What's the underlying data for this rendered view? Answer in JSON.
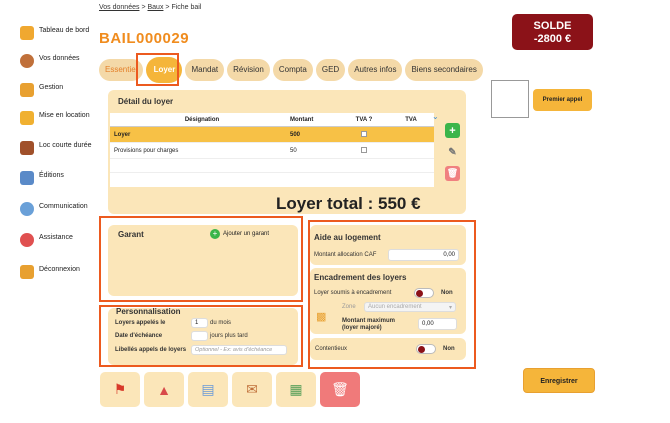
{
  "sidebar": {
    "items": [
      {
        "label": "Tableau de bord",
        "icon": "dashboard-icon",
        "color": "#f0a830"
      },
      {
        "label": "Vos données",
        "icon": "user-icon",
        "color": "#c0703a"
      },
      {
        "label": "Gestion",
        "icon": "building-icon",
        "color": "#e8a030"
      },
      {
        "label": "Mise en location",
        "icon": "key-icon",
        "color": "#f0b030"
      },
      {
        "label": "Loc courte durée",
        "icon": "suitcase-icon",
        "color": "#a0502a"
      },
      {
        "label": "Éditions",
        "icon": "document-icon",
        "color": "#5a8ac8"
      },
      {
        "label": "Communication",
        "icon": "chat-icon",
        "color": "#6aa0d8"
      },
      {
        "label": "Assistance",
        "icon": "support-icon",
        "color": "#e05050"
      },
      {
        "label": "Déconnexion",
        "icon": "logout-icon",
        "color": "#e8a030"
      }
    ]
  },
  "breadcrumb": {
    "link1": "Vos données",
    "sep1": ">",
    "link2": "Baux",
    "sep2": ">",
    "current": "Fiche bail"
  },
  "lease_code": "BAIL000029",
  "solde": {
    "label": "SOLDE",
    "amount": "-2800 €"
  },
  "tabs": [
    "Essentiel",
    "Loyer",
    "Mandat",
    "Révision",
    "Compta",
    "GED",
    "Autres infos",
    "Biens secondaires"
  ],
  "active_tab": "Loyer",
  "premier_appel": "Premier appel",
  "detail": {
    "title": "Détail du loyer",
    "columns": [
      "Désignation",
      "Montant",
      "TVA ?",
      "TVA"
    ],
    "rows": [
      {
        "designation": "Loyer",
        "montant": "500"
      },
      {
        "designation": "Provisions pour charges",
        "montant": "50"
      }
    ],
    "total": "Loyer total : 550 €"
  },
  "garant": {
    "title": "Garant",
    "add_label": "Ajouter un garant"
  },
  "perso": {
    "title": "Personnalisation",
    "loyers_label": "Loyers appelés le",
    "loyers_value": "1",
    "loyers_suffix": "du mois",
    "echeance_label": "Date d'échéance",
    "echeance_suffix": "jours plus tard",
    "libelles_label": "Libellés appels de loyers",
    "libelles_placeholder": "Optionnel - Ex: avis d'échéance"
  },
  "aide": {
    "title": "Aide au logement",
    "caf_label": "Montant allocation CAF",
    "caf_value": "0,00"
  },
  "encadrement": {
    "title": "Encadrement des loyers",
    "soumis_label": "Loyer soumis à encadrement",
    "soumis_value": "Non",
    "zone_label": "Zone",
    "zone_value": "Aucun encadrement",
    "montant_label_1": "Montant maximum",
    "montant_label_2": "(loyer majoré)",
    "montant_value": "0,00"
  },
  "contentieux": {
    "label": "Contentieux",
    "value": "Non"
  },
  "bottom_tiles": [
    "flag-chart-icon",
    "rocket-icon",
    "certificate-icon",
    "letter-icon",
    "cash-icon",
    "trash-icon"
  ],
  "save_label": "Enregistrer",
  "colors": {
    "accent": "#f5b53a",
    "brand": "#f08c1e",
    "solde_bg": "#8b1218",
    "highlight": "#ec5a1f",
    "panel": "#fbe6b9"
  }
}
